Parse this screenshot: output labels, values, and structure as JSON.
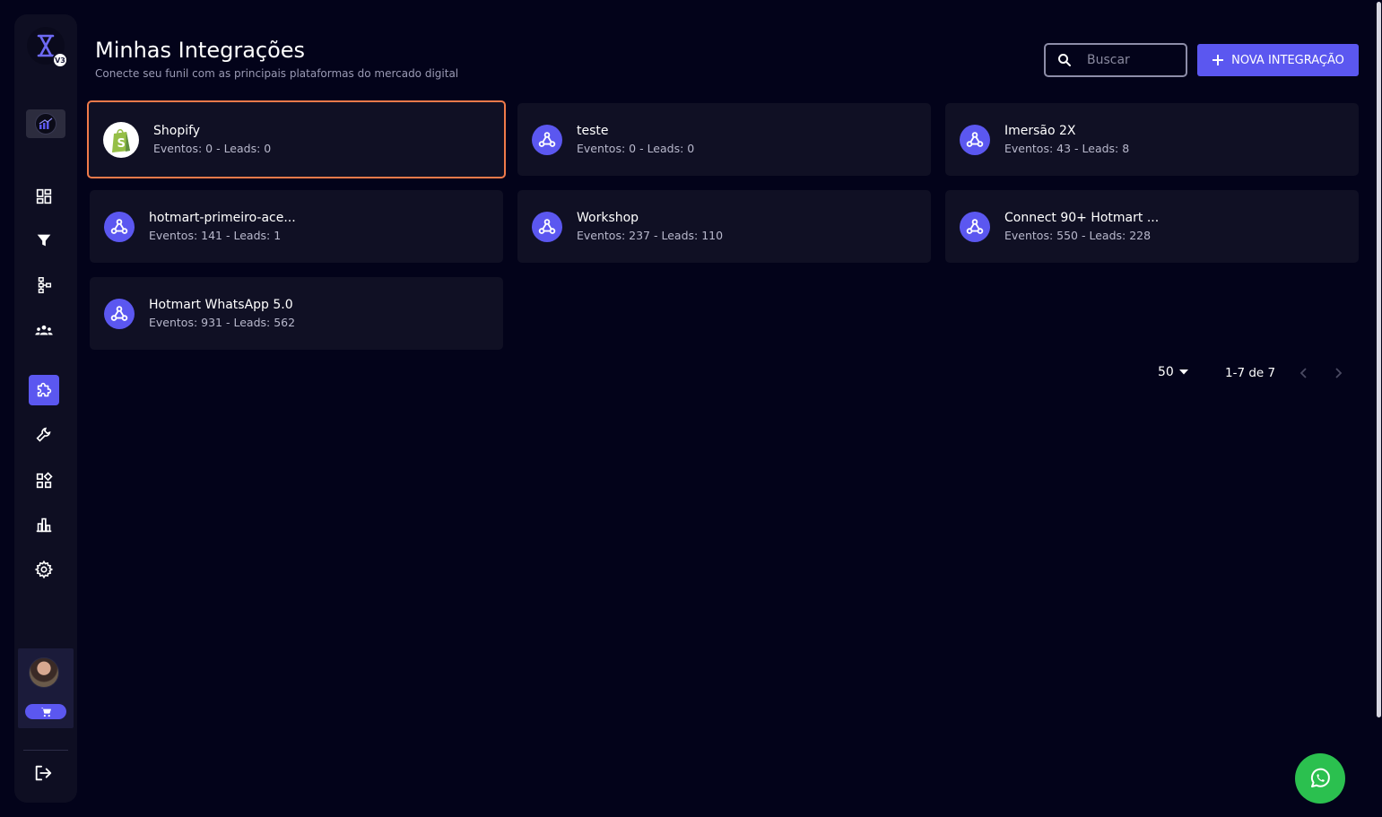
{
  "sidebar": {
    "logo_badge": "V3",
    "nav": [
      {
        "id": "dashboard",
        "icon": "dashboard-icon"
      },
      {
        "id": "funnels",
        "icon": "filter-icon"
      },
      {
        "id": "flows",
        "icon": "flowchart-icon"
      },
      {
        "id": "contacts",
        "icon": "users-icon"
      },
      {
        "id": "integrations",
        "icon": "puzzle-icon",
        "active": true
      },
      {
        "id": "tools",
        "icon": "wrench-icon"
      },
      {
        "id": "apps",
        "icon": "widgets-icon"
      },
      {
        "id": "reports",
        "icon": "bar-chart-icon"
      },
      {
        "id": "settings",
        "icon": "gear-icon"
      }
    ],
    "cart_icon": "cart-icon",
    "logout_icon": "logout-icon"
  },
  "header": {
    "title": "Minhas Integrações",
    "subtitle": "Conecte seu funil com as principais plataformas do mercado digital",
    "search_placeholder": "Buscar",
    "new_button_label": "NOVA INTEGRAÇÃO"
  },
  "integrations": [
    {
      "name": "Shopify",
      "meta": "Eventos: 0 - Leads: 0",
      "icon": "shopify-icon",
      "selected": true
    },
    {
      "name": "teste",
      "meta": "Eventos: 0 - Leads: 0",
      "icon": "webhook-icon"
    },
    {
      "name": "Imersão 2X",
      "meta": "Eventos: 43 - Leads: 8",
      "icon": "webhook-icon"
    },
    {
      "name": "hotmart-primeiro-ace...",
      "meta": "Eventos: 141 - Leads: 1",
      "icon": "webhook-icon"
    },
    {
      "name": "Workshop",
      "meta": "Eventos: 237 - Leads: 110",
      "icon": "webhook-icon"
    },
    {
      "name": "Connect 90+ Hotmart ...",
      "meta": "Eventos: 550 - Leads: 228",
      "icon": "webhook-icon"
    },
    {
      "name": "Hotmart WhatsApp 5.0",
      "meta": "Eventos: 931 - Leads: 562",
      "icon": "webhook-icon"
    }
  ],
  "pagination": {
    "page_size": "50",
    "range": "1-7 de 7"
  },
  "colors": {
    "background": "#03031a",
    "panel": "#101024",
    "accent": "#5b57f0",
    "selected_border": "#f07a4a",
    "whatsapp": "#2bc04f"
  }
}
